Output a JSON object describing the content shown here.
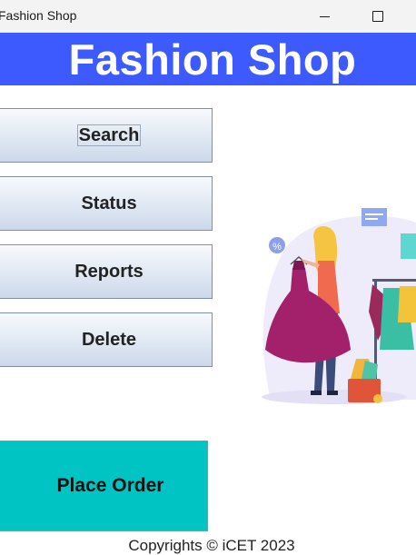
{
  "window": {
    "title": "Fashion Shop"
  },
  "header": {
    "banner_text": "Fashion Shop",
    "banner_color": "#3d5aff"
  },
  "menu": {
    "search_label": "Search",
    "status_label": "Status",
    "reports_label": "Reports",
    "delete_label": "Delete"
  },
  "order": {
    "label": "Place Order",
    "color": "#00c4c4"
  },
  "illustration": {
    "icon": "fashion-shopping-illustration",
    "badge_text": "%"
  },
  "footer": {
    "copyright": "Copyrights © iCET 2023"
  }
}
